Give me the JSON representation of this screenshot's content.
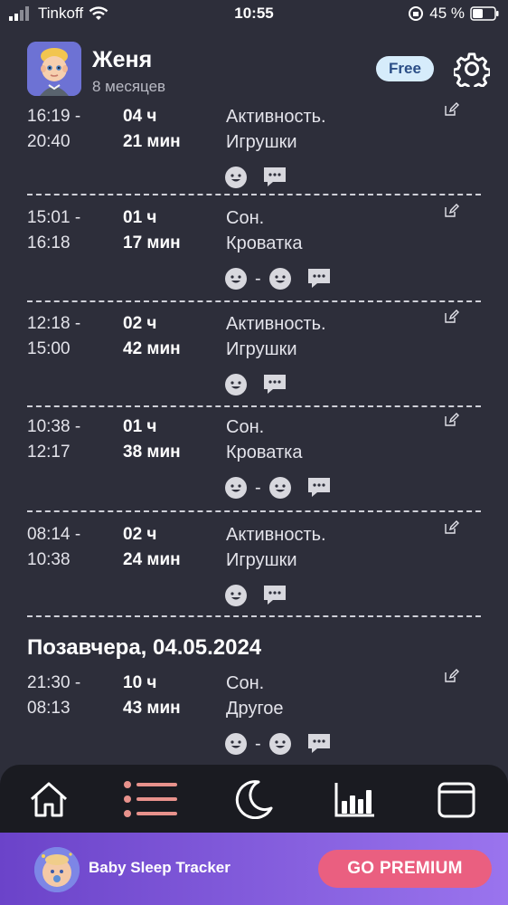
{
  "status_bar": {
    "carrier": "Tinkoff",
    "time": "10:55",
    "battery": "45 %"
  },
  "header": {
    "name": "Женя",
    "age": "8 месяцев",
    "plan_badge": "Free"
  },
  "entries": [
    {
      "start": "16:19 -",
      "end": "20:40",
      "dur_h": "04 ч",
      "dur_m": "21 мин",
      "type": "Активность.",
      "place": "Игрушки",
      "mood": "single"
    },
    {
      "start": "15:01 -",
      "end": "16:18",
      "dur_h": "01 ч",
      "dur_m": "17 мин",
      "type": "Сон.",
      "place": "Кроватка",
      "mood": "range"
    },
    {
      "start": "12:18 -",
      "end": "15:00",
      "dur_h": "02 ч",
      "dur_m": "42 мин",
      "type": "Активность.",
      "place": "Игрушки",
      "mood": "single"
    },
    {
      "start": "10:38 -",
      "end": "12:17",
      "dur_h": "01 ч",
      "dur_m": "38 мин",
      "type": "Сон.",
      "place": "Кроватка",
      "mood": "range"
    },
    {
      "start": "08:14 -",
      "end": "10:38",
      "dur_h": "02 ч",
      "dur_m": "24 мин",
      "type": "Активность.",
      "place": "Игрушки",
      "mood": "single"
    }
  ],
  "day_header": "Позавчера, 04.05.2024",
  "entries_prev": [
    {
      "start": "21:30 -",
      "end": "08:13",
      "dur_h": "10 ч",
      "dur_m": "43 мин",
      "type": "Сон.",
      "place": "Другое",
      "mood": "range"
    }
  ],
  "range_separator": "-",
  "tabs": [
    {
      "icon": "home-icon"
    },
    {
      "icon": "list-icon",
      "active": true
    },
    {
      "icon": "moon-icon"
    },
    {
      "icon": "bar-chart-icon"
    },
    {
      "icon": "calendar-icon"
    }
  ],
  "banner": {
    "title": "Baby Sleep Tracker",
    "button": "GO PREMIUM"
  },
  "colors": {
    "background": "#2d2e3a",
    "tab_active": "#e8928c",
    "premium_button": "#ea5f80",
    "free_badge_bg": "#d6ecfb"
  }
}
